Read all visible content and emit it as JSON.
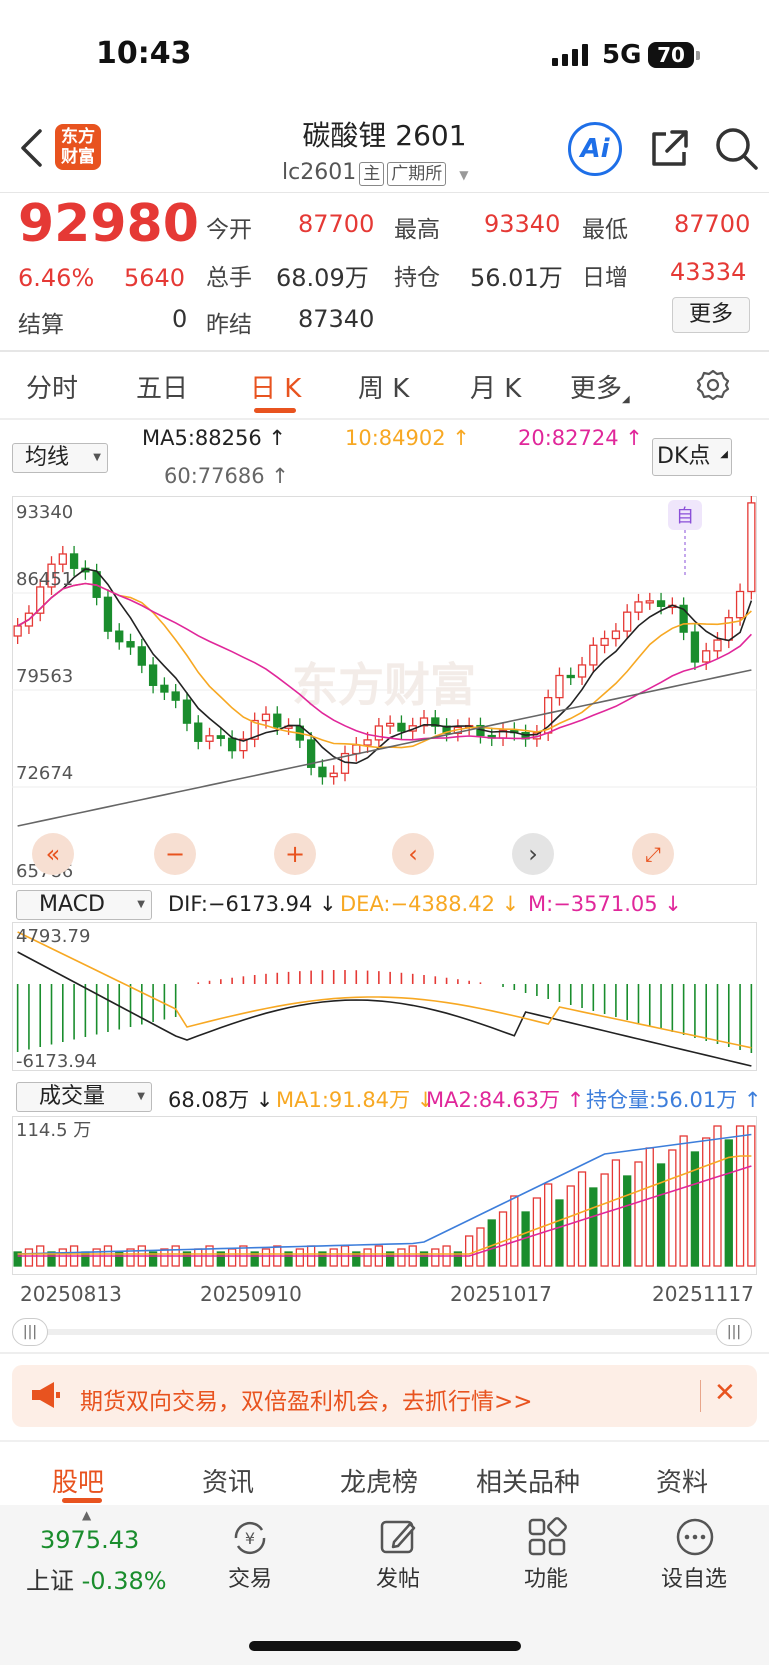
{
  "status_bar": {
    "time": "10:43",
    "network": "5G",
    "battery": "70"
  },
  "header": {
    "logo_text_1": "东方",
    "logo_text_2": "财富",
    "title": "碳酸锂 2601",
    "code": "lc2601",
    "tag_main": "主",
    "tag_exchange": "广期所",
    "ai_label": "Ai"
  },
  "quote": {
    "price": "92980",
    "change_pct": "6.46%",
    "change": "5640",
    "settle_label": "结算",
    "settle": "0",
    "open_label": "今开",
    "open": "87700",
    "high_label": "最高",
    "high": "93340",
    "low_label": "最低",
    "low": "87700",
    "volume_label": "总手",
    "volume": "68.09万",
    "oi_label": "持仓",
    "oi": "56.01万",
    "daily_inc_label": "日增",
    "daily_inc": "43334",
    "prev_settle_label": "昨结",
    "prev_settle": "87340",
    "more_label": "更多"
  },
  "tabs": [
    "分时",
    "五日",
    "日 K",
    "周 K",
    "月 K",
    "更多"
  ],
  "active_tab": "日 K",
  "ma_bar": {
    "selector": "均线",
    "ma5": "MA5:88256 ↑",
    "ma10": "10:84902 ↑",
    "ma20": "20:82724 ↑",
    "ma60": "60:77686 ↑",
    "dk": "DK点"
  },
  "kline": {
    "y_labels": [
      "93340",
      "86451",
      "79563",
      "72674",
      "65786"
    ],
    "watermark": "东方财富",
    "marker": "自",
    "colors": {
      "up": "#e53935",
      "down": "#1a8d2d",
      "ma5": "#222222",
      "ma10": "#f7a823",
      "ma20": "#e0279a",
      "ma60": "#666666"
    }
  },
  "macd": {
    "selector": "MACD",
    "dif": "DIF:−6173.94 ↓",
    "dea": "DEA:−4388.42 ↓",
    "m": "M:−3571.05 ↓",
    "y_top": "4793.79",
    "y_bottom": "-6173.94"
  },
  "volume_panel": {
    "selector": "成交量",
    "vol": "68.08万 ↓",
    "ma1": "MA1:91.84万 ↓",
    "ma2": "MA2:84.63万 ↑",
    "oi": "持仓量:56.01万 ↑",
    "y_top": "114.5 万",
    "dates": [
      "20250813",
      "20250910",
      "20251017",
      "20251117"
    ]
  },
  "banner": {
    "text": "期货双向交易，双倍盈利机会，去抓行情>>"
  },
  "bottom_tabs": [
    "股吧",
    "资讯",
    "龙虎榜",
    "相关品种",
    "资料"
  ],
  "footer": {
    "index_value": "3975.43",
    "index_name": "上证",
    "index_change": "-0.38%",
    "actions": [
      "交易",
      "发帖",
      "功能",
      "设自选"
    ]
  }
}
